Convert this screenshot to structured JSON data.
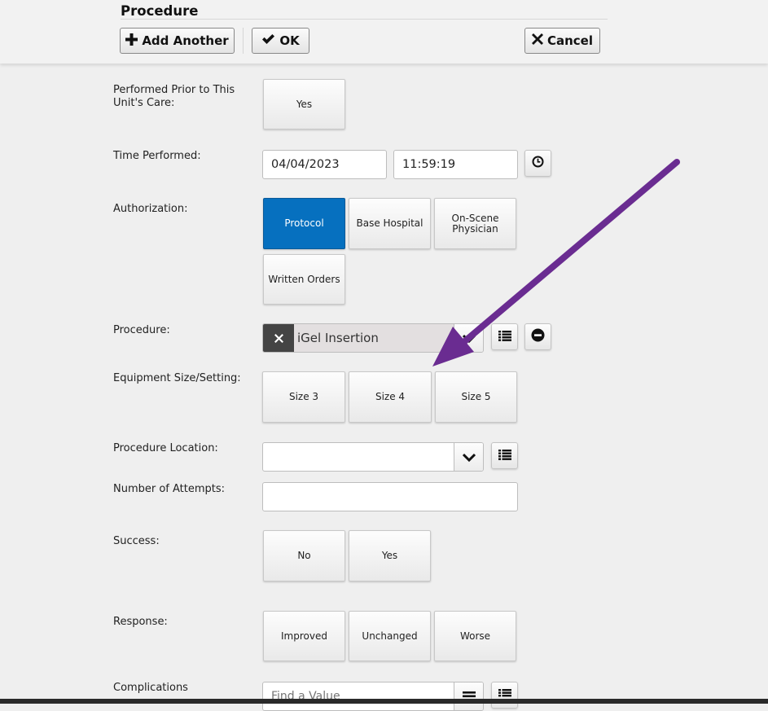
{
  "header": {
    "title": "Procedure",
    "add_another": "Add Another",
    "ok": "OK",
    "cancel": "Cancel"
  },
  "form": {
    "performed_prior": {
      "label": "Performed Prior to This Unit's Care:",
      "options": [
        "Yes"
      ]
    },
    "time_performed": {
      "label": "Time Performed:",
      "date": "04/04/2023",
      "time": "11:59:19"
    },
    "authorization": {
      "label": "Authorization:",
      "options": [
        "Protocol",
        "Base Hospital",
        "On-Scene Physician",
        "Written Orders"
      ],
      "selected": "Protocol"
    },
    "procedure": {
      "label": "Procedure:",
      "value": "iGel Insertion"
    },
    "equipment_size": {
      "label": "Equipment Size/Setting:",
      "options": [
        "Size 3",
        "Size 4",
        "Size 5"
      ]
    },
    "procedure_location": {
      "label": "Procedure Location:",
      "value": ""
    },
    "number_of_attempts": {
      "label": "Number of Attempts:",
      "value": ""
    },
    "success": {
      "label": "Success:",
      "options": [
        "No",
        "Yes"
      ]
    },
    "response": {
      "label": "Response:",
      "options": [
        "Improved",
        "Unchanged",
        "Worse"
      ]
    },
    "complications": {
      "label": "Complications",
      "placeholder": "Find a Value"
    }
  },
  "colors": {
    "selected": "#0670bf",
    "annotation_arrow": "#6a2c91"
  }
}
